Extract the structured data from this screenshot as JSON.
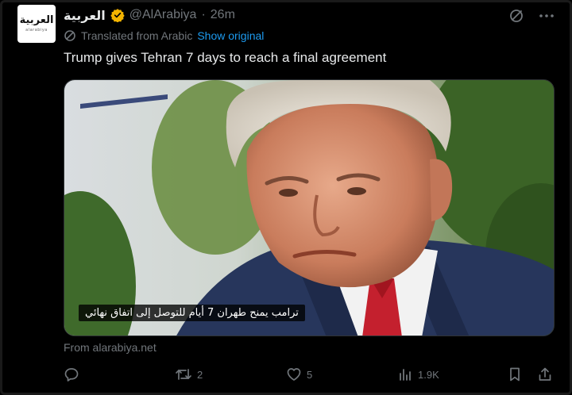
{
  "account": {
    "display_name": "العربية",
    "handle": "@AlArabiya",
    "separator": "·",
    "time": "26m",
    "logo_arabic": "العربية",
    "logo_latin": "alarabiya",
    "verified_color": "#f4b400"
  },
  "header_icons": [
    "grok-icon",
    "more-icon"
  ],
  "translation": {
    "label": "Translated from Arabic",
    "show_original": "Show original"
  },
  "tweet": {
    "text": "Trump gives Tehran 7 days to reach a final agreement"
  },
  "media": {
    "caption": "ترامب يمنح طهران 7 أيام للتوصل إلى اتفاق نهائي"
  },
  "source": {
    "text": "From alarabiya.net"
  },
  "actions": {
    "reply_count": "",
    "repost_count": "2",
    "like_count": "5",
    "views_count": "1.9K"
  },
  "colors": {
    "background": "#000000",
    "text": "#e7e9ea",
    "muted": "#71767b",
    "link": "#1d9bf0"
  }
}
